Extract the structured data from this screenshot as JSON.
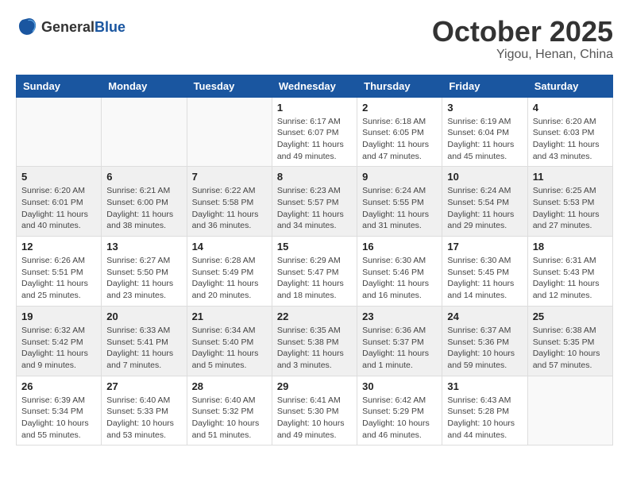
{
  "header": {
    "logo_general": "General",
    "logo_blue": "Blue",
    "month": "October 2025",
    "location": "Yigou, Henan, China"
  },
  "weekdays": [
    "Sunday",
    "Monday",
    "Tuesday",
    "Wednesday",
    "Thursday",
    "Friday",
    "Saturday"
  ],
  "weeks": [
    [
      {
        "day": "",
        "info": ""
      },
      {
        "day": "",
        "info": ""
      },
      {
        "day": "",
        "info": ""
      },
      {
        "day": "1",
        "info": "Sunrise: 6:17 AM\nSunset: 6:07 PM\nDaylight: 11 hours\nand 49 minutes."
      },
      {
        "day": "2",
        "info": "Sunrise: 6:18 AM\nSunset: 6:05 PM\nDaylight: 11 hours\nand 47 minutes."
      },
      {
        "day": "3",
        "info": "Sunrise: 6:19 AM\nSunset: 6:04 PM\nDaylight: 11 hours\nand 45 minutes."
      },
      {
        "day": "4",
        "info": "Sunrise: 6:20 AM\nSunset: 6:03 PM\nDaylight: 11 hours\nand 43 minutes."
      }
    ],
    [
      {
        "day": "5",
        "info": "Sunrise: 6:20 AM\nSunset: 6:01 PM\nDaylight: 11 hours\nand 40 minutes."
      },
      {
        "day": "6",
        "info": "Sunrise: 6:21 AM\nSunset: 6:00 PM\nDaylight: 11 hours\nand 38 minutes."
      },
      {
        "day": "7",
        "info": "Sunrise: 6:22 AM\nSunset: 5:58 PM\nDaylight: 11 hours\nand 36 minutes."
      },
      {
        "day": "8",
        "info": "Sunrise: 6:23 AM\nSunset: 5:57 PM\nDaylight: 11 hours\nand 34 minutes."
      },
      {
        "day": "9",
        "info": "Sunrise: 6:24 AM\nSunset: 5:55 PM\nDaylight: 11 hours\nand 31 minutes."
      },
      {
        "day": "10",
        "info": "Sunrise: 6:24 AM\nSunset: 5:54 PM\nDaylight: 11 hours\nand 29 minutes."
      },
      {
        "day": "11",
        "info": "Sunrise: 6:25 AM\nSunset: 5:53 PM\nDaylight: 11 hours\nand 27 minutes."
      }
    ],
    [
      {
        "day": "12",
        "info": "Sunrise: 6:26 AM\nSunset: 5:51 PM\nDaylight: 11 hours\nand 25 minutes."
      },
      {
        "day": "13",
        "info": "Sunrise: 6:27 AM\nSunset: 5:50 PM\nDaylight: 11 hours\nand 23 minutes."
      },
      {
        "day": "14",
        "info": "Sunrise: 6:28 AM\nSunset: 5:49 PM\nDaylight: 11 hours\nand 20 minutes."
      },
      {
        "day": "15",
        "info": "Sunrise: 6:29 AM\nSunset: 5:47 PM\nDaylight: 11 hours\nand 18 minutes."
      },
      {
        "day": "16",
        "info": "Sunrise: 6:30 AM\nSunset: 5:46 PM\nDaylight: 11 hours\nand 16 minutes."
      },
      {
        "day": "17",
        "info": "Sunrise: 6:30 AM\nSunset: 5:45 PM\nDaylight: 11 hours\nand 14 minutes."
      },
      {
        "day": "18",
        "info": "Sunrise: 6:31 AM\nSunset: 5:43 PM\nDaylight: 11 hours\nand 12 minutes."
      }
    ],
    [
      {
        "day": "19",
        "info": "Sunrise: 6:32 AM\nSunset: 5:42 PM\nDaylight: 11 hours\nand 9 minutes."
      },
      {
        "day": "20",
        "info": "Sunrise: 6:33 AM\nSunset: 5:41 PM\nDaylight: 11 hours\nand 7 minutes."
      },
      {
        "day": "21",
        "info": "Sunrise: 6:34 AM\nSunset: 5:40 PM\nDaylight: 11 hours\nand 5 minutes."
      },
      {
        "day": "22",
        "info": "Sunrise: 6:35 AM\nSunset: 5:38 PM\nDaylight: 11 hours\nand 3 minutes."
      },
      {
        "day": "23",
        "info": "Sunrise: 6:36 AM\nSunset: 5:37 PM\nDaylight: 11 hours\nand 1 minute."
      },
      {
        "day": "24",
        "info": "Sunrise: 6:37 AM\nSunset: 5:36 PM\nDaylight: 10 hours\nand 59 minutes."
      },
      {
        "day": "25",
        "info": "Sunrise: 6:38 AM\nSunset: 5:35 PM\nDaylight: 10 hours\nand 57 minutes."
      }
    ],
    [
      {
        "day": "26",
        "info": "Sunrise: 6:39 AM\nSunset: 5:34 PM\nDaylight: 10 hours\nand 55 minutes."
      },
      {
        "day": "27",
        "info": "Sunrise: 6:40 AM\nSunset: 5:33 PM\nDaylight: 10 hours\nand 53 minutes."
      },
      {
        "day": "28",
        "info": "Sunrise: 6:40 AM\nSunset: 5:32 PM\nDaylight: 10 hours\nand 51 minutes."
      },
      {
        "day": "29",
        "info": "Sunrise: 6:41 AM\nSunset: 5:30 PM\nDaylight: 10 hours\nand 49 minutes."
      },
      {
        "day": "30",
        "info": "Sunrise: 6:42 AM\nSunset: 5:29 PM\nDaylight: 10 hours\nand 46 minutes."
      },
      {
        "day": "31",
        "info": "Sunrise: 6:43 AM\nSunset: 5:28 PM\nDaylight: 10 hours\nand 44 minutes."
      },
      {
        "day": "",
        "info": ""
      }
    ]
  ]
}
